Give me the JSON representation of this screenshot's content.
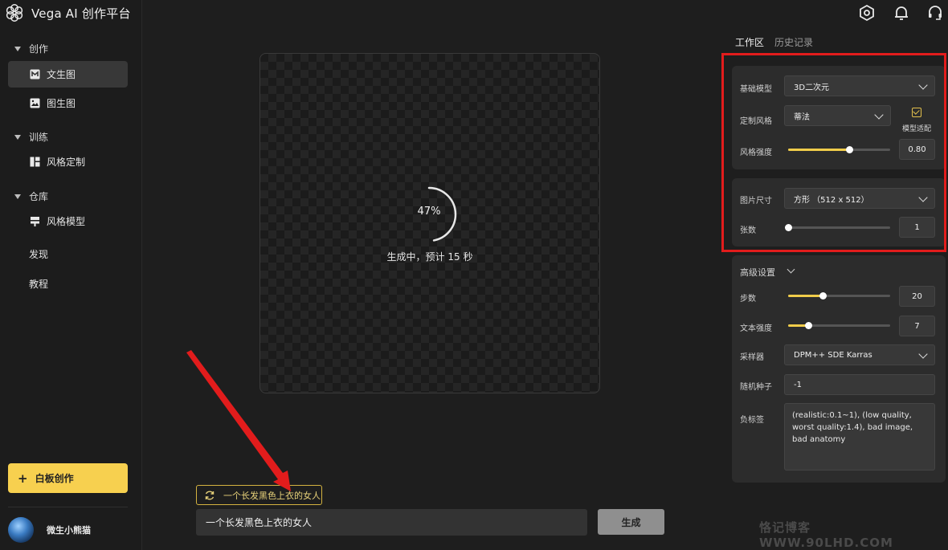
{
  "app": {
    "title": "Vega AI 创作平台"
  },
  "sidebar": {
    "sections": [
      {
        "label": "创作",
        "items": [
          {
            "label": "文生图",
            "active": true
          },
          {
            "label": "图生图"
          }
        ]
      },
      {
        "label": "训练",
        "items": [
          {
            "label": "风格定制"
          }
        ]
      },
      {
        "label": "仓库",
        "items": [
          {
            "label": "风格模型"
          }
        ]
      }
    ],
    "links": [
      "发现",
      "教程"
    ],
    "whiteboard_button": "白板创作",
    "user": {
      "name": "微生小熊猫"
    }
  },
  "topbar": {
    "icons": [
      "settings-hex-icon",
      "bell-icon",
      "headset-icon"
    ]
  },
  "canvas": {
    "progress_percent": 47,
    "progress_label": "47%",
    "status_text": "生成中，预计 15 秒"
  },
  "prompt": {
    "history_chip": "一个长发黑色上衣的女人",
    "value": "一个长发黑色上衣的女人",
    "generate_button": "生成"
  },
  "right_panel": {
    "tabs": [
      {
        "label": "工作区",
        "active": true
      },
      {
        "label": "历史记录",
        "active": false
      }
    ],
    "base_model": {
      "label": "基础模型",
      "value": "3D二次元"
    },
    "custom_style": {
      "label": "定制风格",
      "value": "蒂法",
      "model_fit_label": "模型适配",
      "model_fit_checked": true
    },
    "style_strength": {
      "label": "风格强度",
      "value": "0.80",
      "fraction": 0.6
    },
    "image_size": {
      "label": "图片尺寸",
      "value": "方形 （512 x 512）"
    },
    "count": {
      "label": "张数",
      "value": "1",
      "fraction": 0.0
    },
    "advanced": {
      "label": "高级设置",
      "steps": {
        "label": "步数",
        "value": "20",
        "fraction": 0.34
      },
      "text_strength": {
        "label": "文本强度",
        "value": "7",
        "fraction": 0.2
      },
      "sampler": {
        "label": "采样器",
        "value": "DPM++ SDE Karras"
      },
      "seed": {
        "label": "随机种子",
        "value": "-1"
      },
      "negative": {
        "label": "负标签",
        "value": "(realistic:0.1~1), (low quality, worst quality:1.4), bad image, bad anatomy"
      }
    }
  },
  "colors": {
    "accent": "#f7d04f",
    "annotation_red": "#e21c1c",
    "background": "#1e1e1e"
  },
  "watermark": "恪记博客 WWW.90LHD.COM"
}
